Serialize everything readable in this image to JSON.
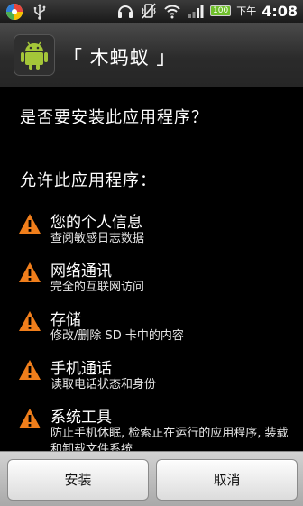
{
  "status_bar": {
    "icons_left": [
      "pinwheel-icon",
      "usb-icon"
    ],
    "icons_right": [
      "headset-icon",
      "vibrate-icon",
      "wifi-icon",
      "signal-icon",
      "battery-icon"
    ],
    "battery_level": "100",
    "ampm": "下午",
    "time": "4:08"
  },
  "header": {
    "app_name": "「 木蚂蚁 」",
    "icon": "android-robot-icon"
  },
  "main": {
    "question": "是否要安装此应用程序？",
    "allow_heading": "允许此应用程序：",
    "permissions": [
      {
        "title": "您的个人信息",
        "desc": "查阅敏感日志数据"
      },
      {
        "title": "网络通讯",
        "desc": "完全的互联网访问"
      },
      {
        "title": "存储",
        "desc": "修改/删除 SD 卡中的内容"
      },
      {
        "title": "手机通话",
        "desc": "读取电话状态和身份"
      },
      {
        "title": "系统工具",
        "desc": "防止手机休眠, 检索正在运行的应用程序, 装载和卸载文件系统"
      }
    ]
  },
  "buttons": {
    "install": "安装",
    "cancel": "取消"
  },
  "colors": {
    "warning": "#f07e1b",
    "background": "#000000",
    "android_green": "#a4c639"
  }
}
